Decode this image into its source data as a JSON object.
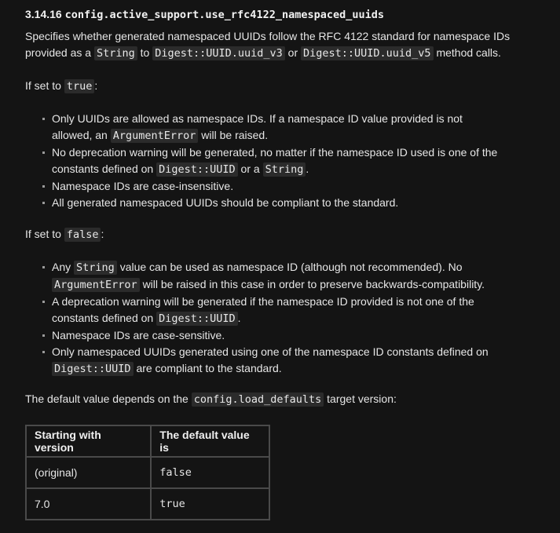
{
  "section": {
    "number": "3.14.16",
    "title_code": "config.active_support.use_rfc4122_namespaced_uuids"
  },
  "intro": {
    "line1": "Specifies whether generated namespaced UUIDs follow the RFC 4122 standard for namespace IDs",
    "line2_a": "provided as a",
    "line2_code1": "String",
    "line2_b": "to",
    "line2_code2": "Digest::UUID.uuid_v3",
    "line2_c": "or",
    "line2_code3": "Digest::UUID.uuid_v5",
    "line2_d": "method calls."
  },
  "if_true": {
    "label": "If set to",
    "code": "true",
    "colon": ":",
    "items": {
      "i1_line1": "Only UUIDs are allowed as namespace IDs. If a namespace ID value provided is not",
      "i1_line2_a": "allowed, an",
      "i1_line2_code": "ArgumentError",
      "i1_line2_b": "will be raised.",
      "i2_line1": "No deprecation warning will be generated, no matter if the namespace ID used is one of the",
      "i2_line2_a": "constants defined on",
      "i2_line2_code1": "Digest::UUID",
      "i2_line2_b": "or a",
      "i2_line2_code2": "String",
      "i2_line2_c": ".",
      "i3": "Namespace IDs are case-insensitive.",
      "i4": "All generated namespaced UUIDs should be compliant to the standard."
    }
  },
  "if_false": {
    "label": "If set to",
    "code": "false",
    "colon": ":",
    "items": {
      "i1_line1_a": "Any",
      "i1_line1_code": "String",
      "i1_line1_b": "value can be used as namespace ID (although not recommended). No",
      "i1_line2_code": "ArgumentError",
      "i1_line2_b": "will be raised in this case in order to preserve backwards-compatibility.",
      "i2_line1": "A deprecation warning will be generated if the namespace ID provided is not one of the",
      "i2_line2_a": "constants defined on",
      "i2_line2_code": "Digest::UUID",
      "i2_line2_b": ".",
      "i3": "Namespace IDs are case-sensitive.",
      "i4_line1": "Only namespaced UUIDs generated using one of the namespace ID constants defined on",
      "i4_line2_code": "Digest::UUID",
      "i4_line2_b": "are compliant to the standard."
    }
  },
  "default_line": {
    "a": "The default value depends on the",
    "code": "config.load_defaults",
    "b": "target version:"
  },
  "table": {
    "headers": [
      "Starting with version",
      "The default value is"
    ],
    "rows": [
      [
        "(original)",
        "false"
      ],
      [
        "7.0",
        "true"
      ]
    ]
  }
}
